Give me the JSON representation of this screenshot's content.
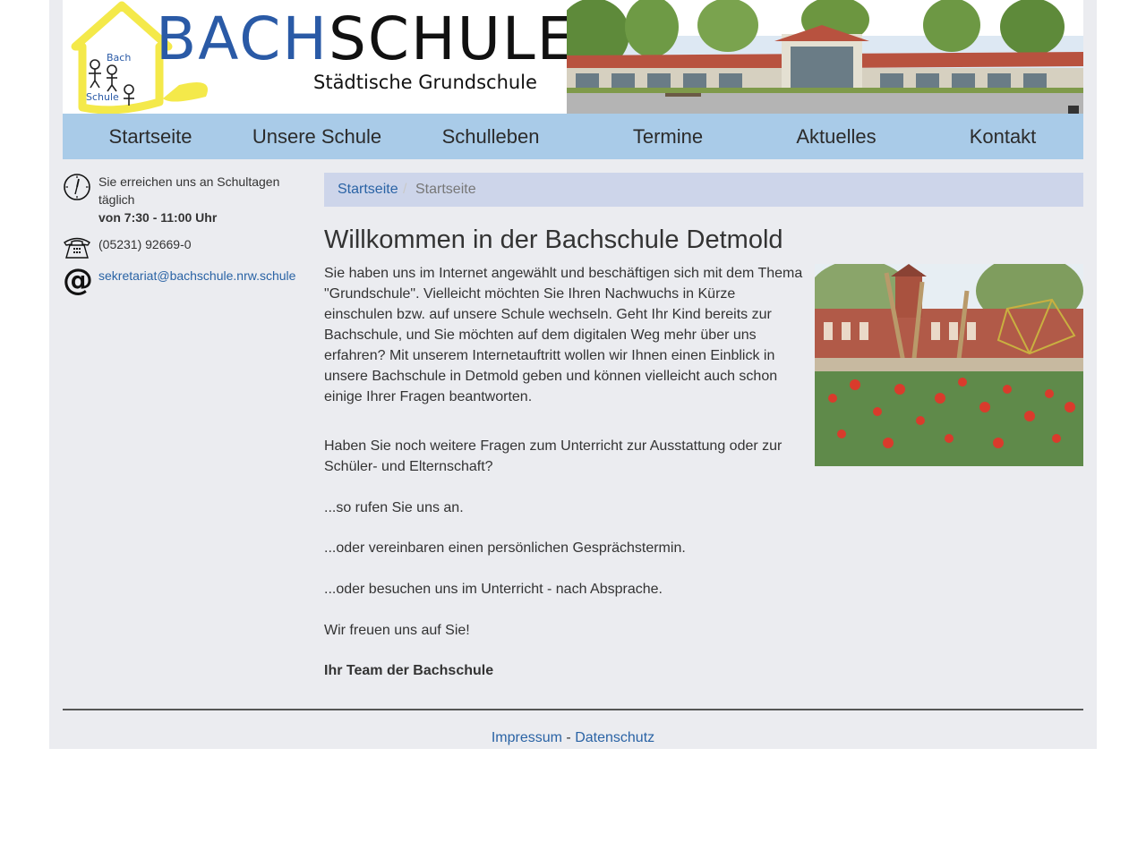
{
  "header": {
    "logo_part1": "BACH",
    "logo_part2": "SCHULE",
    "logo_subtitle": "Städtische Grundschule",
    "logo_house_word1": "Bach",
    "logo_house_word2": "Schule"
  },
  "nav": {
    "items": [
      {
        "label": "Startseite"
      },
      {
        "label": "Unsere Schule"
      },
      {
        "label": "Schulleben"
      },
      {
        "label": "Termine"
      },
      {
        "label": "Aktuelles"
      },
      {
        "label": "Kontakt"
      }
    ]
  },
  "sidebar": {
    "hours_line1": "Sie erreichen uns an Schultagen täglich",
    "hours_line2": "von 7:30 - 11:00 Uhr",
    "phone": "(05231) 92669-0",
    "email": "sekretariat@bachschule.nrw.schule"
  },
  "breadcrumb": {
    "home": "Startseite",
    "separator": "/",
    "current": "Startseite"
  },
  "content": {
    "title": "Willkommen in der Bachschule Detmold",
    "intro": "Sie haben uns im Internet angewählt und beschäftigen sich mit dem Thema \"Grundschule\". Vielleicht möchten Sie Ihren Nachwuchs in Kürze einschulen bzw. auf unsere Schule wechseln. Geht Ihr Kind bereits zur Bachschule, und Sie möchten auf dem digitalen Weg mehr über uns erfahren? Mit unserem Internetauftritt wollen wir Ihnen einen Einblick in unsere Bachschule in Detmold geben und können vielleicht auch schon einige Ihrer Fragen beantworten.",
    "question": "Haben Sie noch weitere Fragen zum Unterricht zur Ausstattung oder zur Schüler- und Elternschaft?",
    "call": "...so rufen Sie uns an.",
    "appointment": "...oder vereinbaren einen persönlichen Gesprächstermin.",
    "visit": "...oder besuchen uns im Unterricht - nach Absprache.",
    "welcome": "Wir freuen uns auf Sie!",
    "signature": "Ihr Team der Bachschule"
  },
  "footer": {
    "impressum": "Impressum",
    "separator": "-",
    "datenschutz": "Datenschutz"
  },
  "colors": {
    "nav_background": "#a9cbe8",
    "page_background": "#ebecf0",
    "breadcrumb_background": "#cdd5ea",
    "link": "#2a63a5",
    "logo_blue": "#2a5aa6",
    "logo_yellow": "#f4e94a"
  },
  "icons": {
    "hours": "clock-icon",
    "phone": "telephone-icon",
    "email": "at-sign-icon"
  }
}
